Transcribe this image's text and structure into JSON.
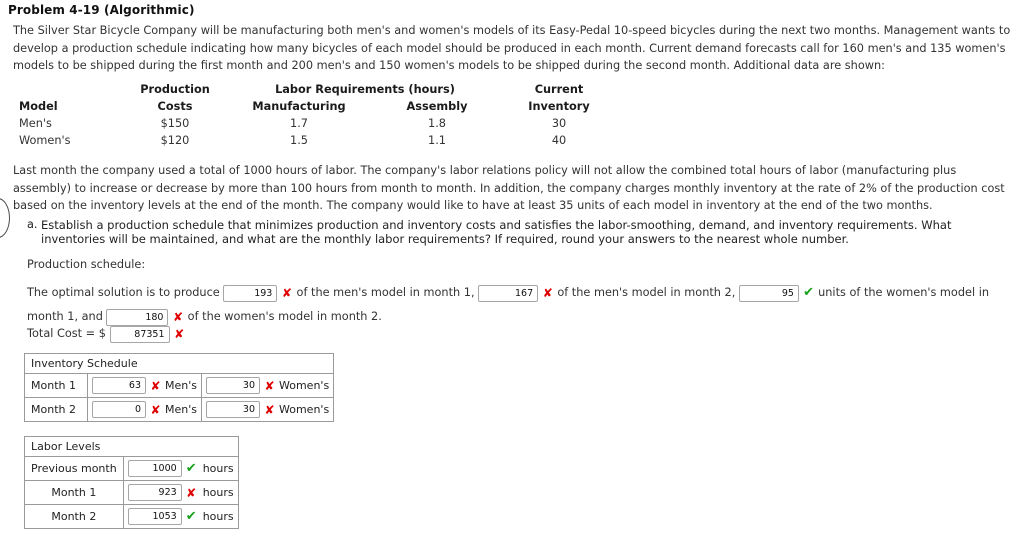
{
  "page": {
    "title": "Problem 4-19 (Algorithmic)",
    "intro_paragraph": "The Silver Star Bicycle Company will be manufacturing both men's and women's models of its Easy-Pedal 10-speed bicycles during the next two months. Management wants to develop a production schedule indicating how many bicycles of each model should be produced in each month. Current demand forecasts call for 160 men's and 135 women's models to be shipped during the first month and 200 men's and 150 women's models to be shipped during the second month. Additional data are shown:",
    "policy_paragraph": "Last month the company used a total of 1000 hours of labor. The company's labor relations policy will not allow the combined total hours of labor (manufacturing plus assembly) to increase or decrease by more than 100 hours from month to month. In addition, the company charges monthly inventory at the rate of 2% of the production cost based on the inventory levels at the end of the month. The company would like to have at least 35 units of each model in inventory at the end of the two months."
  },
  "data_table": {
    "header_row_1": {
      "model": "",
      "production": "Production",
      "labor": "Labor Requirements (hours)",
      "current": "Current"
    },
    "header_row_2": {
      "model": "Model",
      "costs": "Costs",
      "manufacturing": "Manufacturing",
      "assembly": "Assembly",
      "inventory": "Inventory"
    },
    "rows": [
      {
        "model": "Men's",
        "cost": "$150",
        "manufacturing": "1.7",
        "assembly": "1.8",
        "inventory": "30"
      },
      {
        "model": "Women's",
        "cost": "$120",
        "manufacturing": "1.5",
        "assembly": "1.1",
        "inventory": "40"
      }
    ]
  },
  "question_a": {
    "marker": "a.",
    "text": "Establish a production schedule that minimizes production and inventory costs and satisfies the labor-smoothing, demand, and inventory requirements. What inventories will be maintained, and what are the monthly labor requirements? If required, round your answers to the nearest whole number.",
    "production_schedule_label": "Production schedule:"
  },
  "solution": {
    "prefix": "The optimal solution is to produce",
    "men_month1_value": "193",
    "men_month1_status": "✘",
    "men_month1_status_kind": "wrong",
    "text_after_men1": "of the men's model in month 1,",
    "men_month2_value": "167",
    "men_month2_status": "✘",
    "men_month2_status_kind": "wrong",
    "text_after_men2": "of the men's model in month 2,",
    "women_month1_value": "95",
    "women_month1_status": "✔",
    "women_month1_status_kind": "right",
    "text_after_women1": "units of the women's model in month 1, and",
    "women_month2_value": "180",
    "women_month2_status": "✘",
    "women_month2_status_kind": "wrong",
    "text_after_women2": "of the women's model in month 2.",
    "total_cost_label": "Total Cost = $",
    "total_cost_value": "87351",
    "total_cost_status": "✘",
    "total_cost_status_kind": "wrong"
  },
  "inventory_schedule": {
    "caption": "Inventory Schedule",
    "rows": [
      {
        "label": "Month 1",
        "mens_value": "63",
        "mens_status": "✘",
        "mens_status_kind": "wrong",
        "mens_label": "Men's",
        "womens_value": "30",
        "womens_status": "✘",
        "womens_status_kind": "wrong",
        "womens_label": "Women's"
      },
      {
        "label": "Month 2",
        "mens_value": "0",
        "mens_status": "✘",
        "mens_status_kind": "wrong",
        "mens_label": "Men's",
        "womens_value": "30",
        "womens_status": "✘",
        "womens_status_kind": "wrong",
        "womens_label": "Women's"
      }
    ]
  },
  "labor_levels": {
    "caption": "Labor Levels",
    "unit": "hours",
    "rows": [
      {
        "label": "Previous month",
        "value": "1000",
        "status": "✔",
        "status_kind": "right",
        "unit": "hours"
      },
      {
        "label": "Month 1",
        "value": "923",
        "status": "✘",
        "status_kind": "wrong",
        "unit": "hours"
      },
      {
        "label": "Month 2",
        "value": "1053",
        "status": "✔",
        "status_kind": "right",
        "unit": "hours"
      }
    ]
  },
  "colors": {
    "wrong": "#e00000",
    "right": "#17a01a",
    "text": "#333333",
    "border": "#9a9a9a"
  }
}
